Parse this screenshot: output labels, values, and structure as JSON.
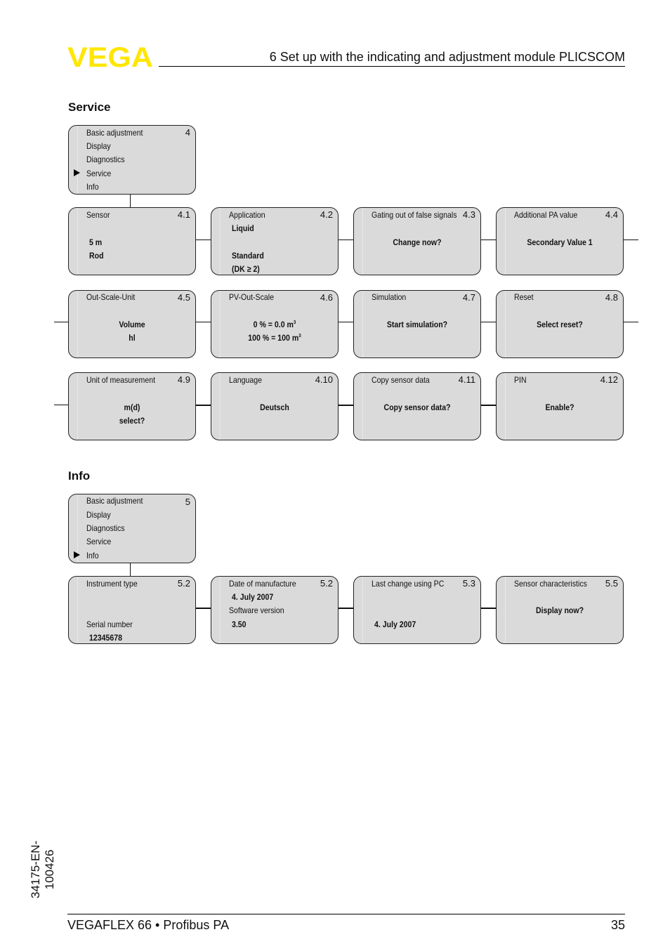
{
  "header": {
    "logo_text": "VEGA",
    "logo_color": "#ffe600",
    "chapter_title": "6   Set up with the indicating and adjustment module PLICSCOM"
  },
  "service": {
    "title": "Service",
    "menu": {
      "number": "4",
      "items": [
        "Basic adjustment",
        "Display",
        "Diagnostics",
        "Service",
        "Info"
      ],
      "selected": "Service"
    },
    "boxes": [
      {
        "title": "Sensor",
        "number": "4.1",
        "lines": [
          "5 m",
          "Rod"
        ]
      },
      {
        "title": "Application",
        "number": "4.2",
        "lines": [
          "Liquid",
          "Standard",
          "(DK ≥ 2)"
        ]
      },
      {
        "title": "Gating out of false signals",
        "number": "4.3",
        "lines": [
          "Change now?"
        ]
      },
      {
        "title": "Additional PA value",
        "number": "4.4",
        "lines": [
          "Secondary Value 1"
        ]
      },
      {
        "title": "Out-Scale-Unit",
        "number": "4.5",
        "lines": [
          "Volume",
          "hl"
        ]
      },
      {
        "title": "PV-Out-Scale",
        "number": "4.6",
        "lines": [
          "0 % = 0.0 m",
          "100 % = 100 m"
        ],
        "superscript": "3"
      },
      {
        "title": "Simulation",
        "number": "4.7",
        "lines": [
          "Start simulation?"
        ]
      },
      {
        "title": "Reset",
        "number": "4.8",
        "lines": [
          "Select reset?"
        ]
      },
      {
        "title": "Unit of measurement",
        "number": "4.9",
        "lines": [
          "m(d)",
          "select?"
        ]
      },
      {
        "title": "Language",
        "number": "4.10",
        "lines": [
          "Deutsch"
        ]
      },
      {
        "title": "Copy sensor data",
        "number": "4.11",
        "lines": [
          "Copy sensor data?"
        ]
      },
      {
        "title": "PIN",
        "number": "4.12",
        "lines": [
          "Enable?"
        ]
      }
    ]
  },
  "info": {
    "title": "Info",
    "menu": {
      "number": "5",
      "items": [
        "Basic adjustment",
        "Display",
        "Diagnostics",
        "Service",
        "Info"
      ],
      "selected": "Info"
    },
    "boxes": [
      {
        "title": "Instrument type",
        "number": "5.2",
        "lines": [
          "Serial number",
          "12345678"
        ]
      },
      {
        "title": "Date of manufacture",
        "number": "5.2",
        "lines": [
          "4. July 2007",
          "Software version",
          "3.50"
        ]
      },
      {
        "title": "Last change using PC",
        "number": "5.3",
        "lines": [
          "4. July 2007"
        ]
      },
      {
        "title": "Sensor characteristics",
        "number": "5.5",
        "lines": [
          "Display now?"
        ]
      }
    ]
  },
  "footer": {
    "product": "VEGAFLEX 66 • Profibus PA",
    "page_number": "35",
    "doc_id": "34175-EN-100426"
  }
}
